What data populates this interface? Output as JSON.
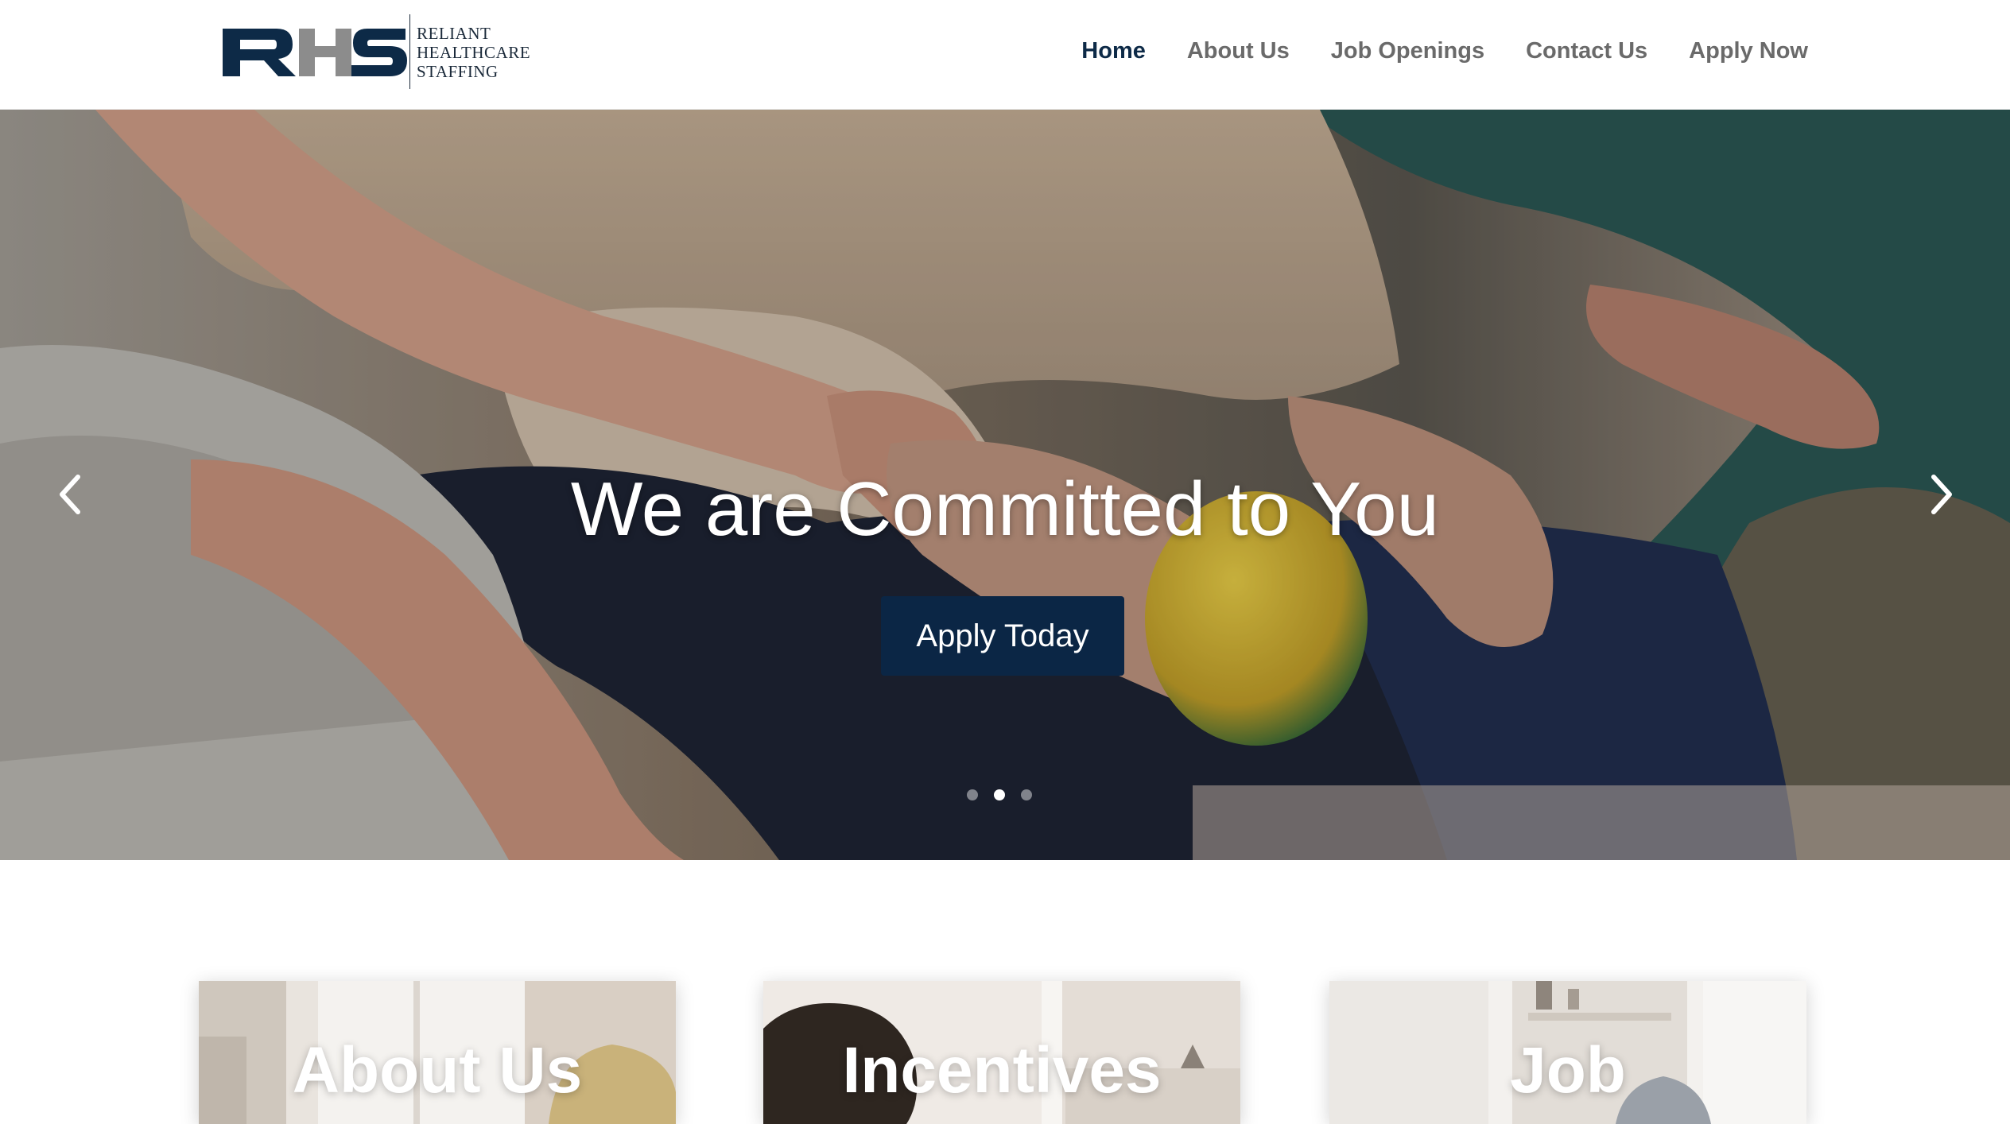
{
  "brand": {
    "monogram": "RHS",
    "name_lines": [
      "RELIANT",
      "HEALTHCARE",
      "STAFFING"
    ],
    "primary_color": "#0d2a47",
    "accent_color": "#8c8c8c"
  },
  "nav": {
    "items": [
      {
        "label": "Home",
        "active": true
      },
      {
        "label": "About Us",
        "active": false
      },
      {
        "label": "Job Openings",
        "active": false
      },
      {
        "label": "Contact Us",
        "active": false
      },
      {
        "label": "Apply Now",
        "active": false
      }
    ]
  },
  "hero": {
    "title": "We are Committed to You",
    "cta_label": "Apply Today",
    "prev_icon": "chevron-left-icon",
    "next_icon": "chevron-right-icon",
    "slide_count": 3,
    "active_slide": 2
  },
  "cards": [
    {
      "title": "About Us"
    },
    {
      "title": "Incentives"
    },
    {
      "title": "Job"
    }
  ]
}
